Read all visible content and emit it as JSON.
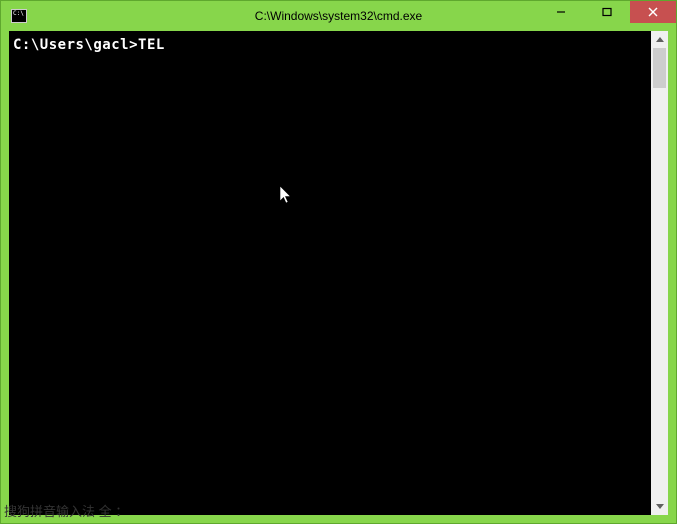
{
  "window": {
    "title": "C:\\Windows\\system32\\cmd.exe"
  },
  "terminal": {
    "prompt": "C:\\Users\\gacl>",
    "command": "TEL"
  },
  "ime": {
    "status": "搜狗拼音输入法 全 ："
  },
  "controls": {
    "minimize": "minimize",
    "maximize": "maximize",
    "close": "close"
  }
}
